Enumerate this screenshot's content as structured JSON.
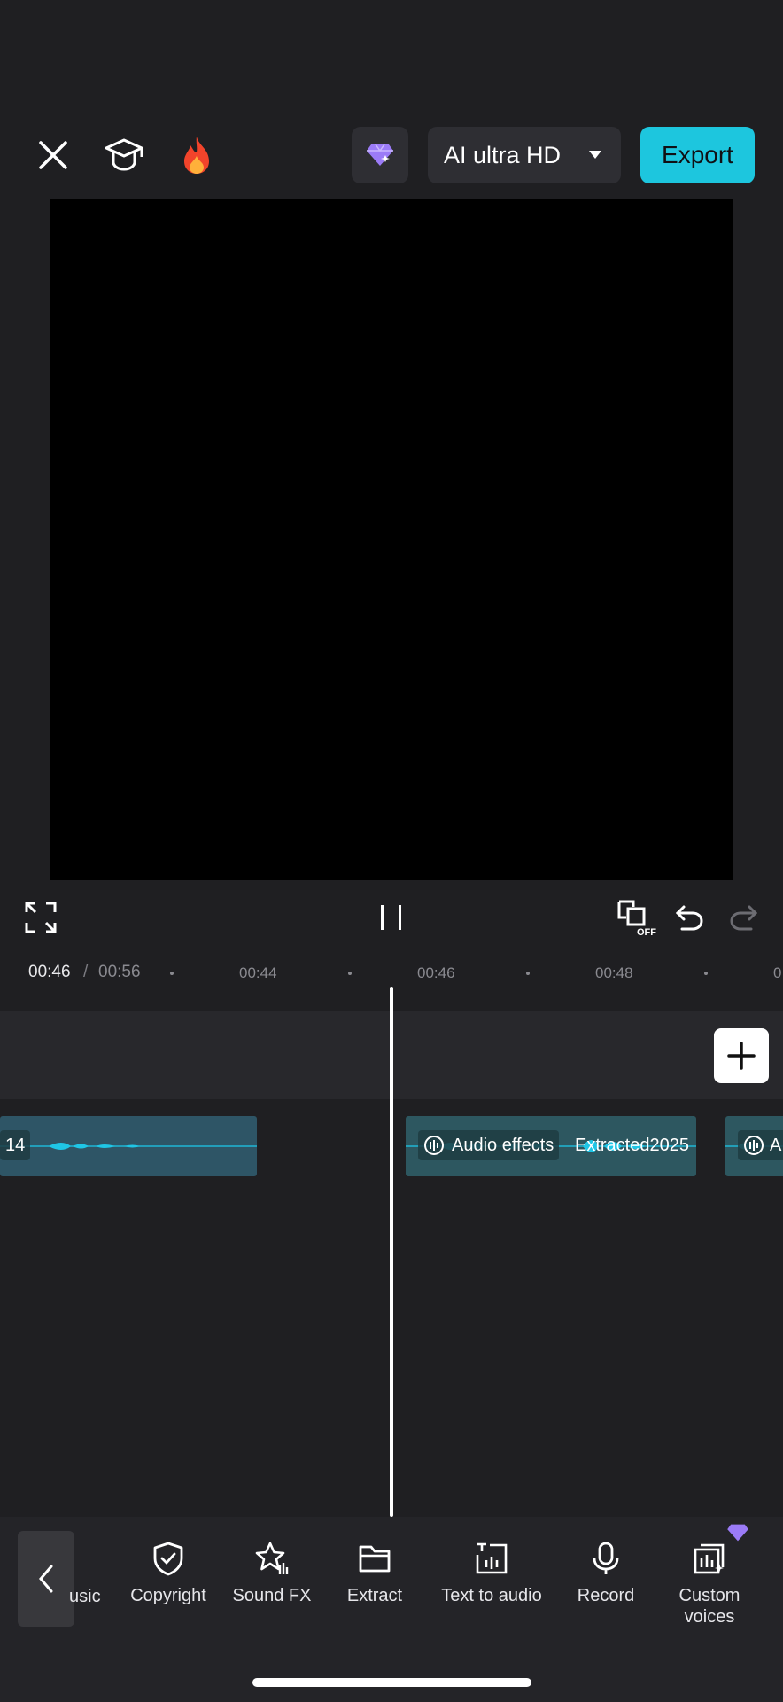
{
  "header": {
    "quality_label": "AI ultra HD",
    "export_label": "Export"
  },
  "timeline": {
    "current_time": "00:46",
    "separator": "/",
    "total_time": "00:56",
    "ticks": [
      "00:44",
      "00:46",
      "00:48",
      "0"
    ]
  },
  "clips": {
    "clip1_label": "14",
    "clip2_chip": "Audio effects",
    "clip2_name": "Extracted2025",
    "clip3_label": "A"
  },
  "toolbar": {
    "partial_label": "usic",
    "items": [
      {
        "label": "Copyright"
      },
      {
        "label": "Sound FX"
      },
      {
        "label": "Extract"
      },
      {
        "label": "Text to audio"
      },
      {
        "label": "Record"
      },
      {
        "label": "Custom voices"
      }
    ]
  },
  "colors": {
    "accent": "#1dc6de",
    "premium": "#9b7bf7",
    "background": "#1f1f22"
  }
}
